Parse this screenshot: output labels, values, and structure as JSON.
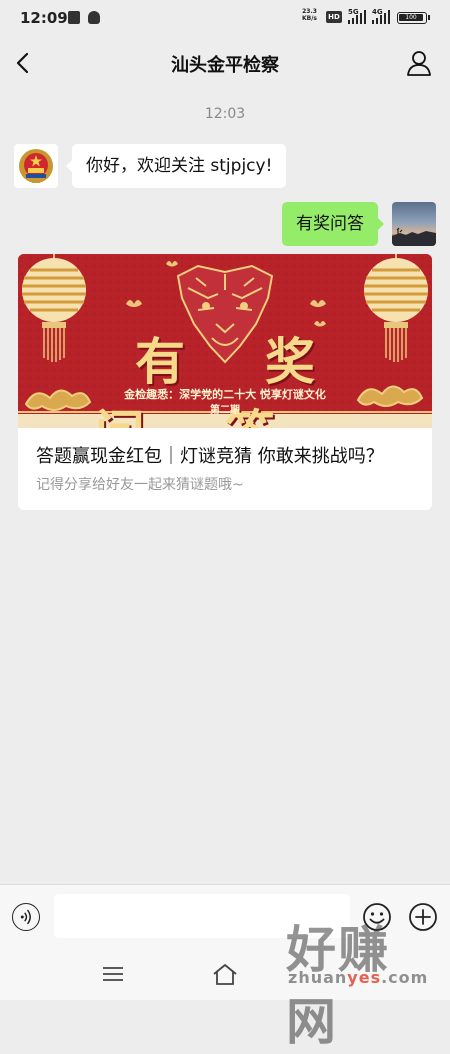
{
  "status_bar": {
    "time": "12:09",
    "net_speed": "23.3",
    "net_unit": "KB/s",
    "hd_label": "HD",
    "sim1_label": "5G",
    "sim2_label": "4G",
    "battery_label": "100"
  },
  "nav": {
    "title": "汕头金平检察",
    "back_icon": "chevron-left-icon",
    "profile_icon": "person-icon"
  },
  "chat": {
    "timestamp": "12:03",
    "welcome_message": "你好，欢迎关注 stjpjcy!",
    "user_message": "有奖问答"
  },
  "article": {
    "cover_headline": "有奖问答",
    "cover_subline": "金检趣悉：深学党的二十大 悦享灯谜文化",
    "cover_issue": "第二期",
    "title": "答题赢现金红包｜灯谜竞猜 你敢来挑战吗？",
    "description": "记得分享给好友一起来猜谜题哦~"
  },
  "input_bar": {
    "placeholder": "",
    "voice_icon": "voice-icon",
    "emoji_icon": "emoji-icon",
    "plus_icon": "plus-circle-icon"
  },
  "watermark": {
    "text_big": "好赚网",
    "text_small_1": "zhuan",
    "text_small_2": "yes",
    "text_small_3": ".com"
  },
  "colors": {
    "background": "#ededed",
    "bubble_green": "#95ec69",
    "cover_red": "#b3232a",
    "gold": "#e9c77a"
  }
}
